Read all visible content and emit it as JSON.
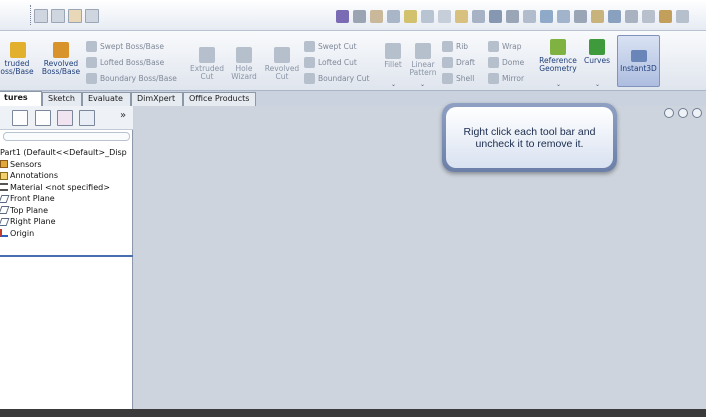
{
  "ribbon": {
    "extruded_boss": "truded\noss/Base",
    "revolved_boss": "Revolved\nBoss/Base",
    "swept_boss": "Swept Boss/Base",
    "lofted_boss": "Lofted Boss/Base",
    "boundary_boss": "Boundary Boss/Base",
    "extruded_cut": "Extruded\nCut",
    "hole_wizard": "Hole\nWizard",
    "revolved_cut": "Revolved\nCut",
    "swept_cut": "Swept Cut",
    "lofted_cut": "Lofted Cut",
    "boundary_cut": "Boundary Cut",
    "fillet": "Fillet",
    "linear_pattern": "Linear\nPattern",
    "rib": "Rib",
    "draft": "Draft",
    "shell": "Shell",
    "wrap": "Wrap",
    "dome": "Dome",
    "mirror": "Mirror",
    "reference_geometry": "Reference\nGeometry",
    "curves": "Curves",
    "instant3d": "Instant3D"
  },
  "tabs": [
    {
      "label": "tures"
    },
    {
      "label": "Sketch"
    },
    {
      "label": "Evaluate"
    },
    {
      "label": "DimXpert"
    },
    {
      "label": "Office Products"
    }
  ],
  "panel": {
    "more": "»",
    "tree": [
      {
        "label": "Part1  (Default<<Default>_Disp"
      },
      {
        "label": "Sensors"
      },
      {
        "label": "Annotations"
      },
      {
        "label": "Material <not specified>"
      },
      {
        "label": "Front Plane"
      },
      {
        "label": "Top Plane"
      },
      {
        "label": "Right Plane"
      },
      {
        "label": "Origin"
      }
    ]
  },
  "tooltip": {
    "text": "Right click each tool bar and uncheck it to remove it."
  }
}
